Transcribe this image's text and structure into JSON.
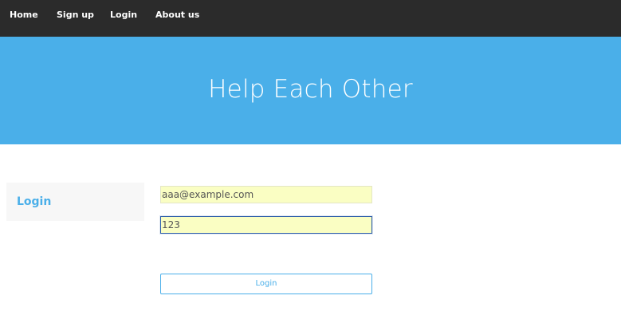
{
  "nav": {
    "items": [
      {
        "label": "Home"
      },
      {
        "label": "Sign up"
      },
      {
        "label": "Login"
      },
      {
        "label": "About us"
      }
    ]
  },
  "hero": {
    "title": "Help Each Other"
  },
  "sidebar": {
    "label": "Login"
  },
  "form": {
    "email_value": "aaa@example.com",
    "password_value": "123",
    "submit_label": "Login"
  },
  "colors": {
    "navbar": "#2b2b2b",
    "accent": "#4aafe9",
    "autofill": "#fafec3"
  }
}
